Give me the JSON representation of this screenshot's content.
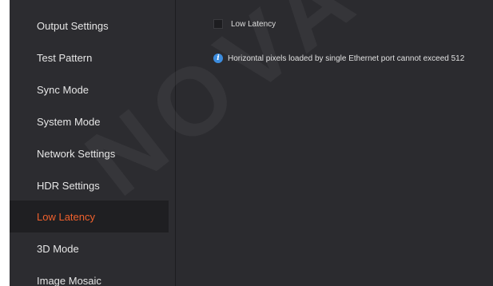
{
  "sidebar": {
    "items": [
      {
        "label": "Output Settings",
        "active": false
      },
      {
        "label": "Test Pattern",
        "active": false
      },
      {
        "label": "Sync Mode",
        "active": false
      },
      {
        "label": "System Mode",
        "active": false
      },
      {
        "label": "Network Settings",
        "active": false
      },
      {
        "label": "HDR Settings",
        "active": false
      },
      {
        "label": "Low Latency",
        "active": true
      },
      {
        "label": "3D Mode",
        "active": false
      },
      {
        "label": "Image Mosaic",
        "active": false
      }
    ]
  },
  "main": {
    "low_latency_checkbox": {
      "label": "Low Latency",
      "checked": false
    },
    "info": {
      "icon": "info-icon",
      "text": "Horizontal pixels loaded by single Ethernet port cannot exceed 512"
    }
  },
  "colors": {
    "sidebar_bg": "#2c2c30",
    "main_bg": "#2b2b2f",
    "active_item_bg": "#1f1f22",
    "active_text": "#f0612d",
    "info_icon": "#3c8cde"
  },
  "watermark": {
    "text": "NOVA"
  }
}
